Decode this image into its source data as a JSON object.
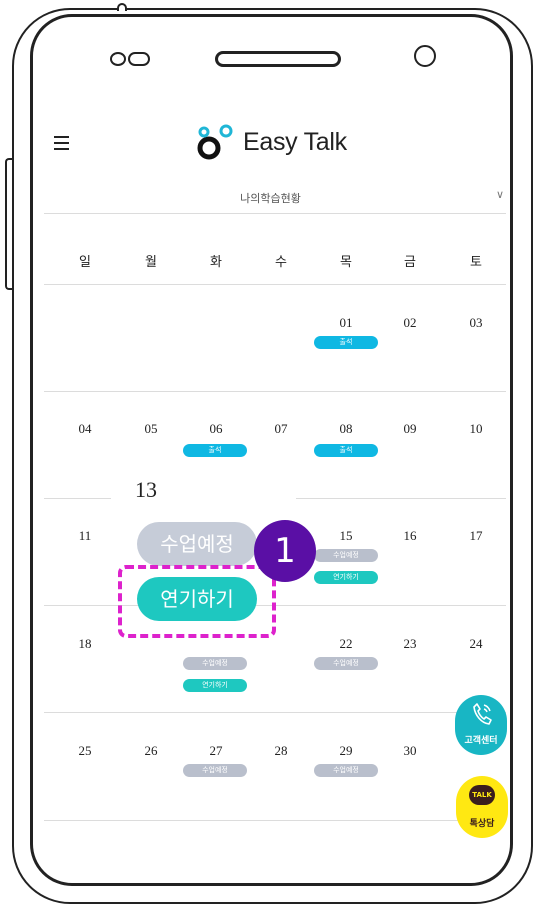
{
  "header": {
    "logo_text": "Easy Talk",
    "calendar_title": "나의학습현황",
    "dropdown_glyph": "∨"
  },
  "calendar": {
    "weekdays": [
      "일",
      "월",
      "화",
      "수",
      "목",
      "금",
      "토"
    ],
    "weeks": [
      [
        "",
        "",
        "",
        "",
        "01",
        "02",
        "03"
      ],
      [
        "04",
        "05",
        "06",
        "07",
        "08",
        "09",
        "10"
      ],
      [
        "11",
        "",
        "",
        "",
        "15",
        "16",
        "17"
      ],
      [
        "18",
        "",
        "",
        "",
        "22",
        "23",
        "24"
      ],
      [
        "25",
        "26",
        "27",
        "28",
        "29",
        "30",
        ""
      ]
    ],
    "tags": {
      "attend": "출석",
      "scheduled": "수업예정",
      "postpone": "연기하기"
    }
  },
  "zoom": {
    "day": "13",
    "scheduled_label": "수업예정",
    "postpone_label": "연기하기",
    "step_number": "1"
  },
  "fab": {
    "support_label": "고객센터",
    "talk_badge": "TALK",
    "chat_label": "톡상담"
  },
  "colors": {
    "attend_pill": "#0fb8e3",
    "scheduled_pill": "#b9bfcc",
    "postpone_pill": "#1ec8c0",
    "step_badge": "#5a0fa5",
    "highlight_dash": "#dd22cc",
    "kakao_yellow": "#ffe812"
  },
  "icons": [
    "menu-icon",
    "easytalk-logo-icon",
    "chevron-down-icon",
    "phone-icon",
    "kakao-talk-icon"
  ]
}
